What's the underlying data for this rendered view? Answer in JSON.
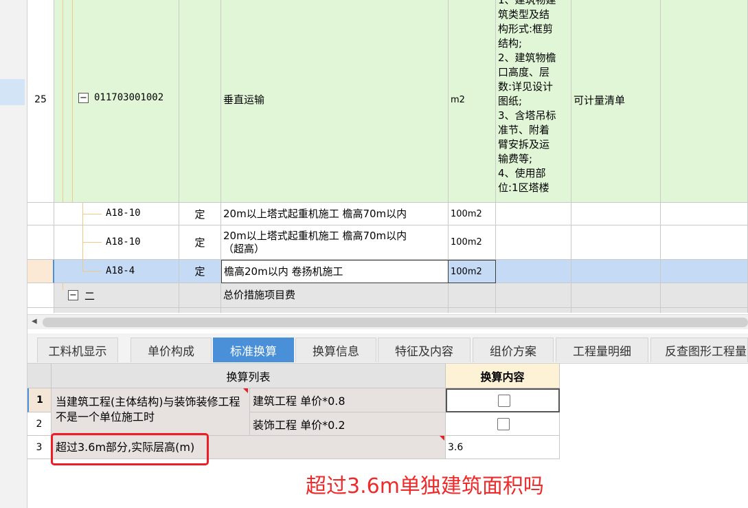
{
  "grid": {
    "rows": [
      {
        "num": "25",
        "code": "011703001002",
        "type": "",
        "name": "垂直运输",
        "unit": "m2",
        "features": "1、建筑物建\n筑类型及结\n构形式:框剪\n结构;\n2、建筑物檐\n口高度、层\n数:详见设计\n图纸;\n3、含塔吊标\n准节、附着\n臂安拆及运\n输费等;\n4、使用部\n位:1区塔楼",
        "remark": "可计量清单"
      },
      {
        "num": "",
        "code": "A18-10",
        "type": "定",
        "name": "20m以上塔式起重机施工 檐高70m以内",
        "unit": "100m2"
      },
      {
        "num": "",
        "code": "A18-10",
        "type": "定",
        "name": "20m以上塔式起重机施工 檐高70m以内（超高）",
        "unit": "100m2"
      },
      {
        "num": "",
        "code": "A18-4",
        "type": "定",
        "name": "檐高20m以内 卷扬机施工",
        "unit": "100m2"
      },
      {
        "num": "",
        "code": "二",
        "type": "",
        "name": "总价措施项目费",
        "unit": ""
      }
    ]
  },
  "tabs": [
    {
      "label": "工料机显示",
      "active": false
    },
    {
      "label": "单价构成",
      "active": false
    },
    {
      "label": "标准换算",
      "active": true
    },
    {
      "label": "换算信息",
      "active": false
    },
    {
      "label": "特征及内容",
      "active": false
    },
    {
      "label": "组价方案",
      "active": false
    },
    {
      "label": "工程量明细",
      "active": false
    },
    {
      "label": "反查图形工程量",
      "active": false
    }
  ],
  "conversion": {
    "col_list": "换算列表",
    "col_content": "换算内容",
    "rows": [
      {
        "num": "1",
        "option": "建筑工程 单价*0.8",
        "checked": false
      },
      {
        "num": "2",
        "option": "装饰工程 单价*0.2",
        "checked": false
      },
      {
        "num": "3",
        "desc": "超过3.6m部分,实际层高(m)",
        "value": "3.6"
      }
    ],
    "group_desc": "当建筑工程(主体结构)与装饰装修工程不是一个单位施工时"
  },
  "annotation": {
    "question": "超过3.6m单独建筑面积吗",
    "color": "#ee2a2a"
  }
}
